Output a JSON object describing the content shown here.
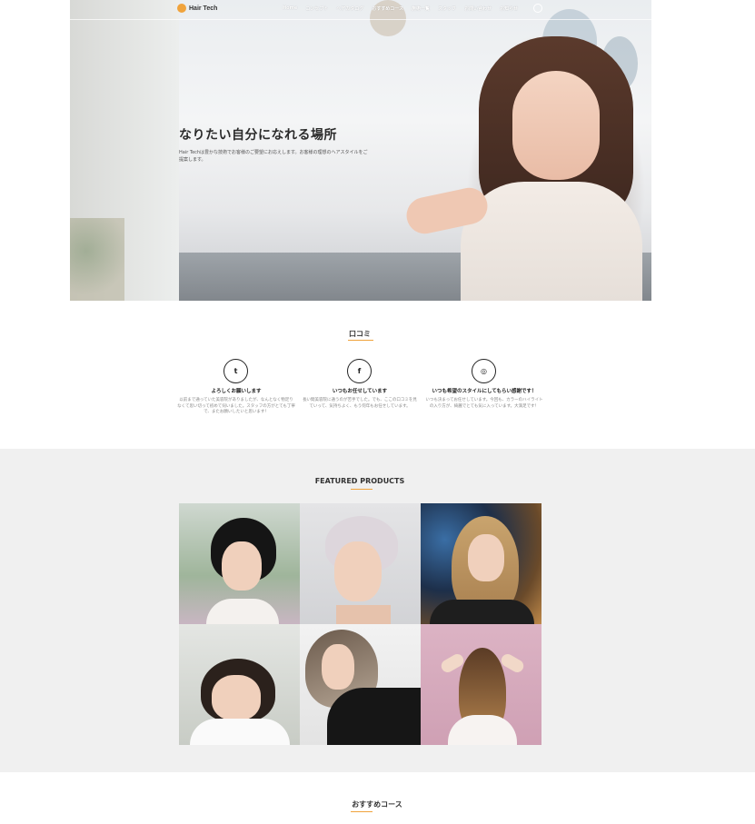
{
  "brand": {
    "name": "Hair Tech",
    "icon": "hair-tech-logo-icon",
    "accent": "#f0a33c"
  },
  "nav": {
    "items": [
      "Home",
      "コンセプト",
      "ヘアカタログ",
      "おすすめコース",
      "施術一覧",
      "スタッフ",
      "お問い合わせ",
      "お知らせ"
    ],
    "active_index": 3,
    "search_icon": "search-icon"
  },
  "hero": {
    "title": "なりたい自分になれる場所",
    "subtitle": "Hair Techは豊かな技術でお客様のご要望にお応えします。お客様の理想のヘアスタイルをご提案します。"
  },
  "reviews": {
    "title": "口コミ",
    "items": [
      {
        "icon": "twitter-icon",
        "glyph": "t",
        "title": "よろしくお願いします",
        "text": "以前まで通っていた美容院がありましたが、なんとなく物足りなくて思い切って初めて伺いました。スタッフの方がとても丁寧で、またお願いしたいと思います！"
      },
      {
        "icon": "facebook-icon",
        "glyph": "f",
        "title": "いつもお任せしています",
        "text": "長い間美容院に通うのが苦手でした。でも、ここの口コミを見ていって、気持ちよく、もう何年もお任せしています。"
      },
      {
        "icon": "instagram-icon",
        "glyph": "◎",
        "title": "いつも希望のスタイルにしてもらい感謝です！",
        "text": "いつも決まってお任せしています。今回も、カラーのハイライトの入り方が、綺麗でとても気に入っています。大満足です！"
      }
    ]
  },
  "products": {
    "title": "FEATURED PRODUCTS"
  },
  "courses": {
    "title": "おすすめコース"
  }
}
